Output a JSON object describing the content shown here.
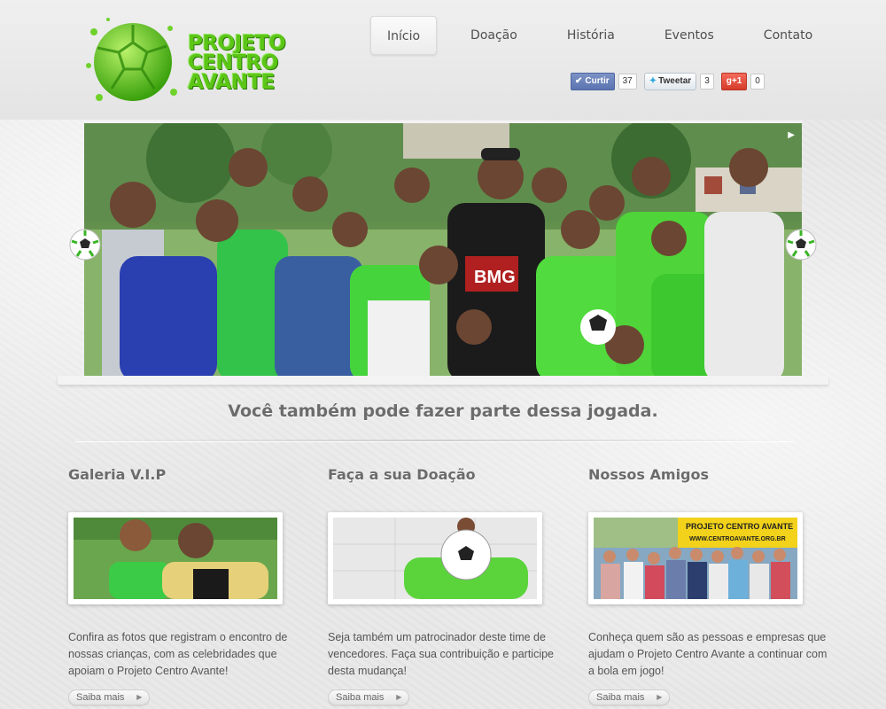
{
  "brand": {
    "line1": "PROJETO",
    "line2": "CENTRO",
    "line3": "AVANTE"
  },
  "nav": {
    "items": [
      {
        "label": "Início",
        "active": true
      },
      {
        "label": "Doação"
      },
      {
        "label": "História"
      },
      {
        "label": "Eventos"
      },
      {
        "label": "Contato"
      }
    ]
  },
  "social": {
    "like_label": "Curtir",
    "like_count": "37",
    "tweet_label": "Tweetar",
    "tweet_count": "3",
    "gplus_label": "+1",
    "gplus_count": "0"
  },
  "hero": {
    "tagline": "Você também pode fazer parte dessa jogada."
  },
  "columns": [
    {
      "title": "Galeria V.I.P",
      "text": "Confira as fotos que registram o encontro de nossas crianças, com as celebridades que apoiam o Projeto Centro Avante!",
      "more": "Saiba mais"
    },
    {
      "title": "Faça a sua Doação",
      "text": "Seja também um patrocinador deste time de vencedores. Faça sua contribuição e participe desta mudança!",
      "more": "Saiba mais"
    },
    {
      "title": "Nossos Amigos",
      "text": "Conheça quem são as pessoas e empresas que ajudam o Projeto Centro Avante a continuar com a bola em jogo!",
      "more": "Saiba mais",
      "banner_line1": "PROJETO CENTRO AVANTE",
      "banner_line2": "WWW.CENTROAVANTE.ORG.BR"
    }
  ],
  "photo": {
    "shirt_text": "BMG"
  },
  "colors": {
    "brand_green": "#5cc617",
    "text": "#5d5d5d"
  }
}
